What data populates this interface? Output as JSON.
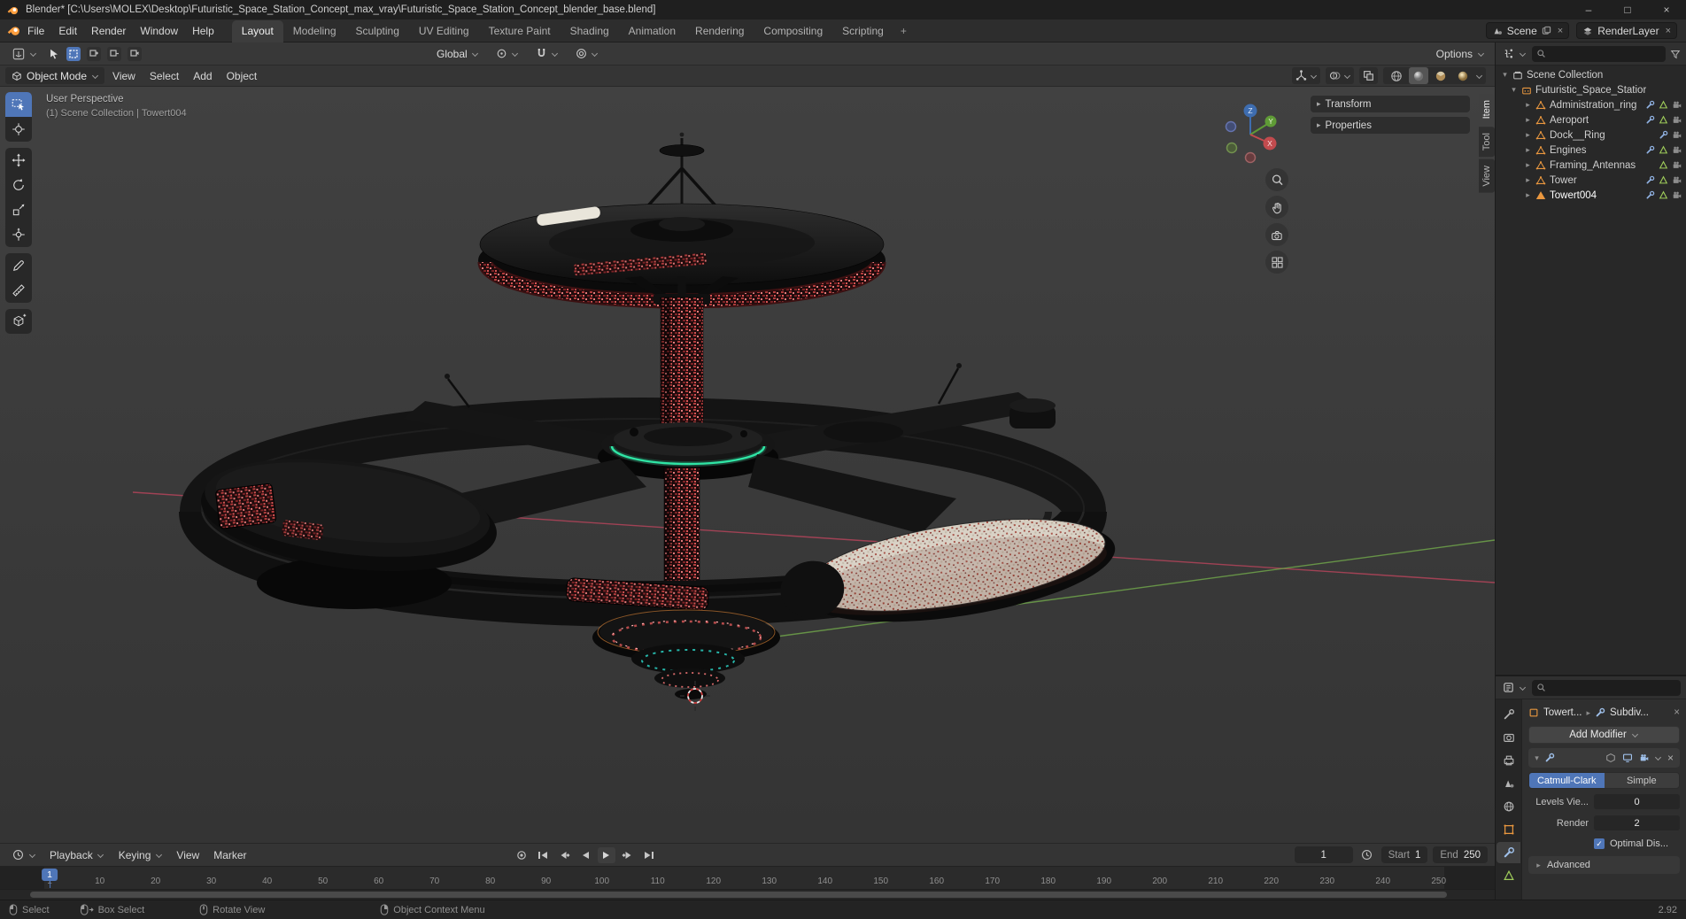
{
  "colors": {
    "accent_blue": "#4f76b8",
    "object_orange": "#e9973f",
    "mesh_data_green": "#9ecb5a",
    "modifier_blue": "#8fb0e0",
    "axis_red": "#b3445a",
    "axis_green": "#6fa34a"
  },
  "title_bar": {
    "title": "Blender* [C:\\Users\\MOLEX\\Desktop\\Futuristic_Space_Station_Concept_max_vray\\Futuristic_Space_Station_Concept_blender_base.blend]",
    "controls": {
      "minimize": "–",
      "maximize": "□",
      "close": "×"
    }
  },
  "topbar": {
    "menus": [
      "File",
      "Edit",
      "Render",
      "Window",
      "Help"
    ],
    "workspace_tabs": [
      "Layout",
      "Modeling",
      "Sculpting",
      "UV Editing",
      "Texture Paint",
      "Shading",
      "Animation",
      "Rendering",
      "Compositing",
      "Scripting"
    ],
    "active_tab": "Layout",
    "new_workspace": "+",
    "scene_name": "Scene",
    "view_layer_name": "RenderLayer"
  },
  "tool_settings_bar": {
    "orientation": "Global",
    "options": "Options"
  },
  "viewport_header": {
    "mode": "Object Mode",
    "menus": [
      "View",
      "Select",
      "Add",
      "Object"
    ]
  },
  "viewport": {
    "overlay": {
      "line1": "User Perspective",
      "line2": "(1) Scene Collection | Towert004"
    },
    "panels": [
      "Transform",
      "Properties"
    ],
    "sidebar_tabs": [
      "Item",
      "Tool",
      "View"
    ],
    "active_sidebar_tab": "Item",
    "gizmo": {
      "x": "X",
      "y": "Y",
      "z": "Z"
    },
    "tools": [
      "select-box",
      "cursor",
      "move",
      "rotate",
      "scale",
      "transform",
      "annotate",
      "measure",
      "add-cube"
    ]
  },
  "outliner": {
    "scene_collection": "Scene Collection",
    "collection": "Futuristic_Space_Statior",
    "objects": [
      {
        "label": "Administration_ring",
        "modifier": true,
        "mesh_data": true
      },
      {
        "label": "Aeroport",
        "modifier": true,
        "mesh_data": true
      },
      {
        "label": "Dock__Ring",
        "modifier": true,
        "mesh_data": false
      },
      {
        "label": "Engines",
        "modifier": true,
        "mesh_data": true
      },
      {
        "label": "Framing_Antennas",
        "modifier": false,
        "mesh_data": true
      },
      {
        "label": "Tower",
        "modifier": true,
        "mesh_data": true
      },
      {
        "label": "Towert004",
        "modifier": true,
        "mesh_data": true,
        "active": true
      }
    ]
  },
  "properties": {
    "breadcrumb": {
      "object": "Towert...",
      "modifier": "Subdiv..."
    },
    "add_modifier": "Add Modifier",
    "modifier": {
      "type_options": [
        "Catmull-Clark",
        "Simple"
      ],
      "active_type": "Catmull-Clark",
      "levels_label": "Levels Vie...",
      "levels_value": "0",
      "render_label": "Render",
      "render_value": "2",
      "optimal_display": "Optimal Dis...",
      "advanced": "Advanced"
    }
  },
  "timeline": {
    "menus": [
      "Playback",
      "Keying",
      "View",
      "Marker"
    ],
    "current_frame": "1",
    "start_label": "Start",
    "start_value": "1",
    "end_label": "End",
    "end_value": "250",
    "ticks": [
      1,
      10,
      20,
      30,
      40,
      50,
      60,
      70,
      80,
      90,
      100,
      110,
      120,
      130,
      140,
      150,
      160,
      170,
      180,
      190,
      200,
      210,
      220,
      230,
      240,
      250
    ],
    "playhead_frame": "1"
  },
  "status_bar": {
    "hints": [
      {
        "icon": "mouse-left",
        "label": "Select"
      },
      {
        "icon": "mouse-left-drag",
        "label": "Box Select"
      },
      {
        "icon": "mouse-middle",
        "label": "Rotate View"
      },
      {
        "icon": "mouse-right",
        "label": "Object Context Menu"
      }
    ],
    "version": "2.92"
  }
}
